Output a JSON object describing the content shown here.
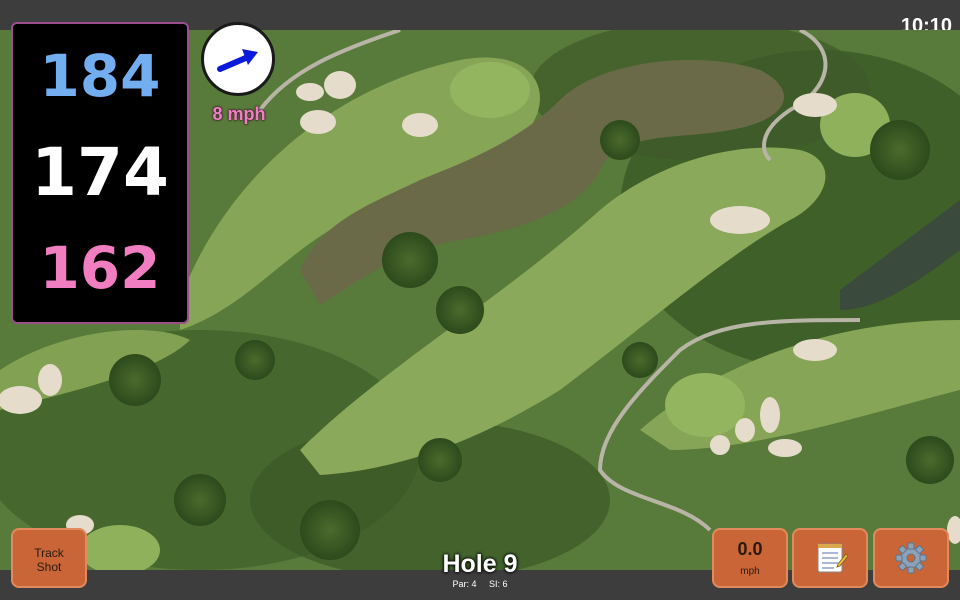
{
  "status": {
    "time": "10:10"
  },
  "distances": {
    "back": "184",
    "center": "174",
    "front": "162"
  },
  "wind": {
    "speed_text": "8 mph",
    "direction_icon": "arrow-up-right-icon"
  },
  "hole": {
    "title": "Hole 9",
    "par": "Par: 4",
    "si": "SI: 6"
  },
  "buttons": {
    "track_shot_line1": "Track",
    "track_shot_line2": "Shot",
    "wind_value": "0.0",
    "wind_unit": "mph",
    "notes_icon": "notepad-icon",
    "settings_icon": "gear-icon"
  },
  "colors": {
    "back_distance": "#72aef0",
    "center_distance": "#ffffff",
    "front_distance": "#f07ec0",
    "button": "#c96536",
    "panel_border": "#9a4e8c"
  }
}
